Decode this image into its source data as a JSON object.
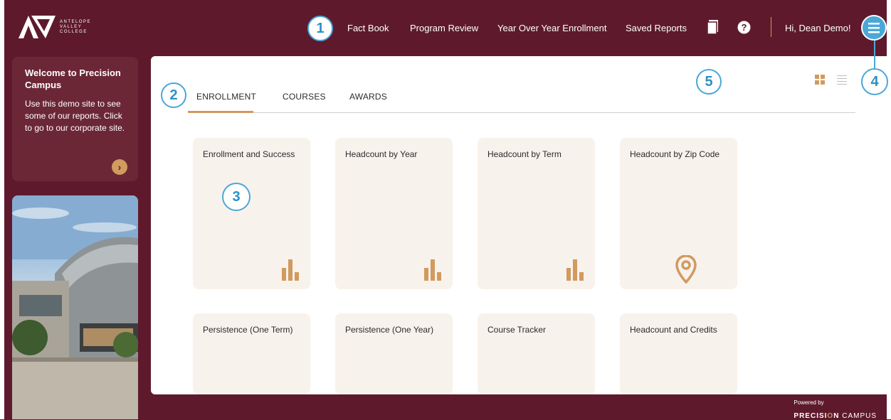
{
  "brand": {
    "logo_lines": [
      "ANTELOPE",
      "VALLEY",
      "COLLEGE"
    ]
  },
  "nav": {
    "links": [
      "Fact Book",
      "Program Review",
      "Year Over Year Enrollment",
      "Saved Reports"
    ],
    "greeting": "Hi, Dean Demo!",
    "icons": [
      "document-icon",
      "help-icon",
      "hamburger-menu-icon"
    ]
  },
  "callouts": [
    "1",
    "2",
    "3",
    "4",
    "5"
  ],
  "sidebar": {
    "welcome_title": "Welcome to Precision Campus",
    "welcome_body": "Use this demo site to see some of our reports. Click to go to our corporate site.",
    "arrow_glyph": "›"
  },
  "tabs": {
    "items": [
      "ENROLLMENT",
      "COURSES",
      "AWARDS"
    ],
    "active": "ENROLLMENT"
  },
  "cards": {
    "row1": [
      {
        "title": "Enrollment and Success",
        "icon": "bar-chart-icon"
      },
      {
        "title": "Headcount by Year",
        "icon": "bar-chart-icon"
      },
      {
        "title": "Headcount by Term",
        "icon": "bar-chart-icon"
      },
      {
        "title": "Headcount by Zip Code",
        "icon": "map-pin-icon"
      }
    ],
    "row2": [
      {
        "title": "Persistence (One Term)"
      },
      {
        "title": "Persistence (One Year)"
      },
      {
        "title": "Course Tracker"
      },
      {
        "title": "Headcount and Credits"
      }
    ]
  },
  "footer": {
    "powered_by": "Powered by",
    "brand_a": "PRECISI",
    "brand_o": "O",
    "brand_b": "N",
    "brand_c": " CAMPUS"
  },
  "colors": {
    "background": "#5e1a2c",
    "accent": "#d19a5f",
    "card": "#f8f2ec",
    "callout": "#4aa7d8"
  }
}
